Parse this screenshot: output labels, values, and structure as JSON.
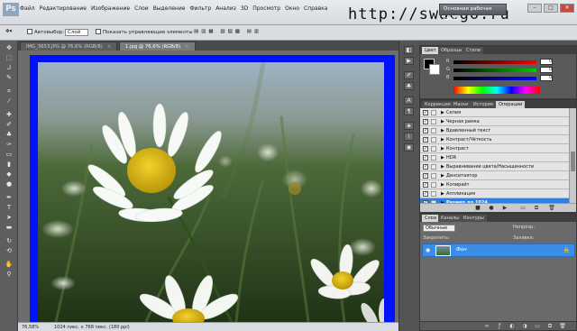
{
  "app": {
    "logo": "Ps",
    "workspace": "Основная рабочая среда",
    "watermark": "http://swaego.ru",
    "window_controls": [
      "–",
      "□",
      "✕"
    ]
  },
  "menu": [
    "Файл",
    "Редактирование",
    "Изображение",
    "Слои",
    "Выделение",
    "Фильтр",
    "Анализ",
    "3D",
    "Просмотр",
    "Окно",
    "Справка"
  ],
  "menu_extras": [
    "76,6",
    "▾"
  ],
  "options": {
    "autoselect_label": "Автовыбор:",
    "autoselect_value": "Слой",
    "show_controls_label": "Показать управляющие элементы"
  },
  "tabs": [
    {
      "label": "IMG_3653.JPG @ 76,6% (RGB/8)",
      "close": "×"
    },
    {
      "label": "1.jpg @ 76,6% (RGB/8)",
      "close": "×"
    }
  ],
  "status": {
    "zoom": "76,58%",
    "info": "1024 пикс. x 768 пикс. (180 ppi)"
  },
  "color_panel": {
    "tabs": [
      "Цвет",
      "Образцы",
      "Стили"
    ],
    "channels": [
      {
        "label": "R",
        "value": "0",
        "color": "#ff0000"
      },
      {
        "label": "G",
        "value": "0",
        "color": "#00b000"
      },
      {
        "label": "B",
        "value": "0",
        "color": "#0000ff"
      }
    ]
  },
  "actions_panel": {
    "tabs": [
      "Коррекция",
      "Маски",
      "История",
      "Операции"
    ],
    "items": [
      "Сепия",
      "Черная рамка",
      "Вдавленный текст",
      "Контраст/Чёткость",
      "Контраст",
      "HDR",
      "Выравнивание цвета/Насыщенности",
      "Денситаятор",
      "Копирайт",
      "Аппликация",
      "Размер до 1024"
    ],
    "selected_index": 10
  },
  "layers_panel": {
    "tabs": [
      "Слои",
      "Каналы",
      "Контуры"
    ],
    "blend_mode": "Обычные",
    "opacity_label": "Непрозр.:",
    "lock_label": "Закрепить:",
    "fill_label": "Заливка:",
    "layer_name": "Фон"
  }
}
